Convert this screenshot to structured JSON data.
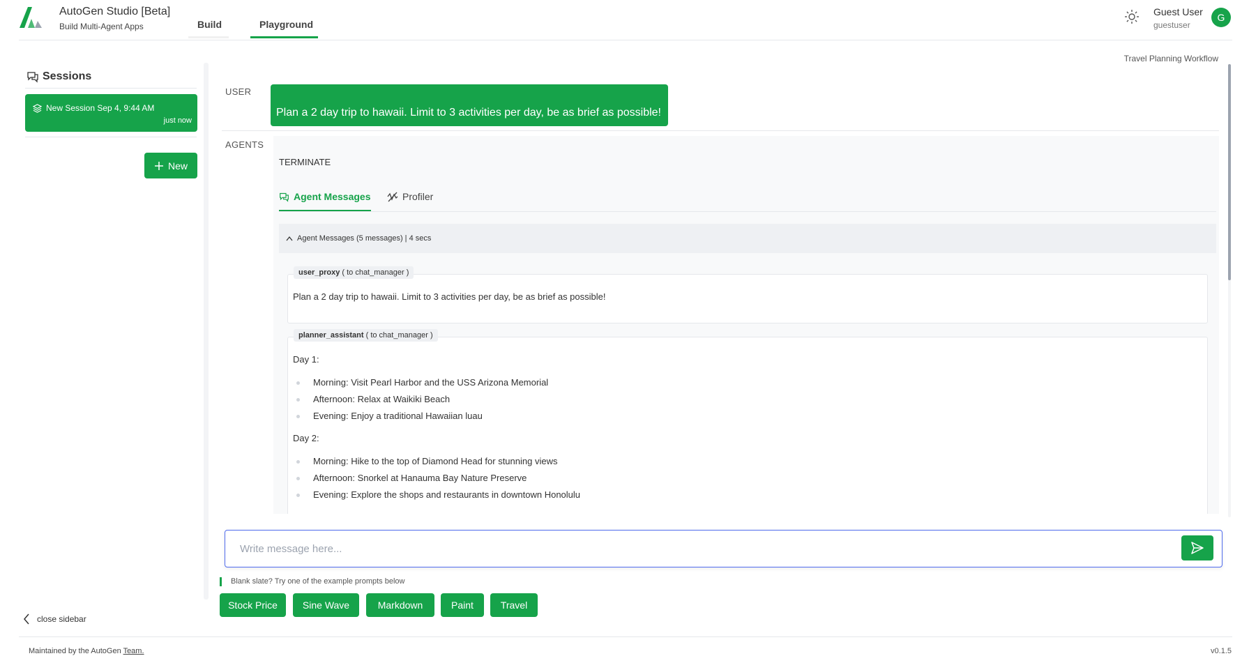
{
  "header": {
    "app_title": "AutoGen Studio [Beta]",
    "app_subtitle": "Build Multi-Agent Apps",
    "tabs": [
      {
        "label": "Build"
      },
      {
        "label": "Playground"
      }
    ],
    "active_tab": "Playground",
    "user_name": "Guest User",
    "user_login": "guestuser",
    "avatar_initial": "G"
  },
  "sidebar": {
    "title": "Sessions",
    "sessions": [
      {
        "name": "New Session Sep 4, 9:44 AM",
        "time": "just now"
      }
    ],
    "new_button": "New",
    "close_label": "close sidebar"
  },
  "main": {
    "workflow_label": "Travel Planning Workflow",
    "user_label": "USER",
    "user_message": "Plan a 2 day trip to hawaii. Limit to 3 activities per day, be as brief as possible!",
    "agents_label": "AGENTS",
    "final_response": "TERMINATE",
    "tabs": [
      {
        "label": "Agent Messages"
      },
      {
        "label": "Profiler"
      }
    ],
    "summary": "Agent Messages (5 messages) | 4 secs",
    "messages": [
      {
        "sender": "user_proxy",
        "recipient": "( to chat_manager )",
        "text": "Plan a 2 day trip to hawaii. Limit to 3 activities per day, be as brief as possible!"
      },
      {
        "sender": "planner_assistant",
        "recipient": "( to chat_manager )",
        "day1_heading": "Day 1:",
        "day1_items": [
          "Morning: Visit Pearl Harbor and the USS Arizona Memorial",
          "Afternoon: Relax at Waikiki Beach",
          "Evening: Enjoy a traditional Hawaiian luau"
        ],
        "day2_heading": "Day 2:",
        "day2_items": [
          "Morning: Hike to the top of Diamond Head for stunning views",
          "Afternoon: Snorkel at Hanauma Bay Nature Preserve",
          "Evening: Explore the shops and restaurants in downtown Honolulu"
        ]
      }
    ]
  },
  "input": {
    "placeholder": "Write message here...",
    "hint": "Blank slate? Try one of the example prompts below",
    "examples": [
      "Stock Price",
      "Sine Wave",
      "Markdown",
      "Paint",
      "Travel"
    ]
  },
  "footer": {
    "text_prefix": "Maintained by the AutoGen ",
    "link_text": "Team.",
    "version": "v0.1.5"
  },
  "colors": {
    "accent": "#16a34a",
    "input_border": "#4f6bed"
  }
}
